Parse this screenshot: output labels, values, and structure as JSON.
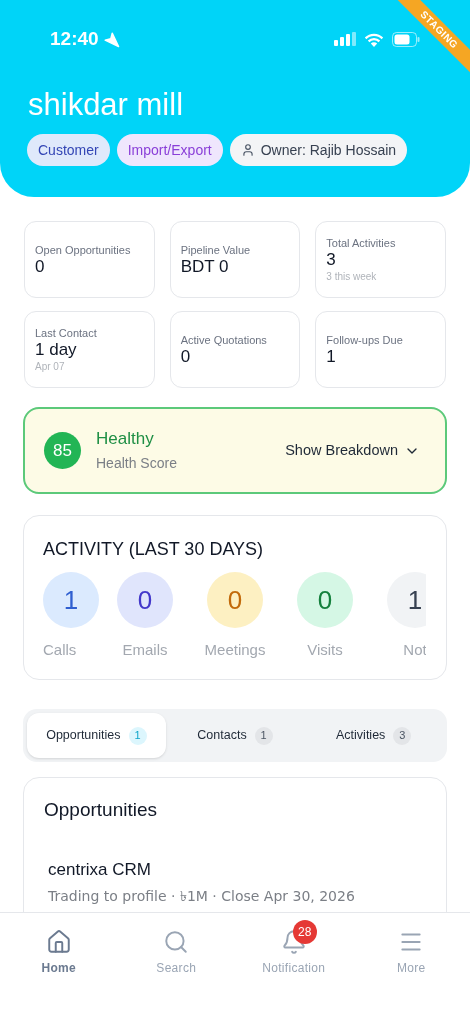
{
  "status_bar": {
    "time": "12:40"
  },
  "ribbon": {
    "label": "STAGING"
  },
  "header": {
    "title": "shikdar mill",
    "chips": [
      {
        "kind": "type",
        "label": "Customer"
      },
      {
        "kind": "industry",
        "label": "Import/Export"
      },
      {
        "kind": "owner",
        "label": "Owner: Rajib Hossain"
      }
    ]
  },
  "stats": [
    {
      "label": "Open Opportunities",
      "value": "0"
    },
    {
      "label": "Pipeline Value",
      "value": "BDT 0"
    },
    {
      "label": "Total Activities",
      "value": "3",
      "note": "3 this week"
    },
    {
      "label": "Last Contact",
      "value": "1 day",
      "note": "Apr 07"
    },
    {
      "label": "Active Quotations",
      "value": "0"
    },
    {
      "label": "Follow-ups Due",
      "value": "1"
    }
  ],
  "health": {
    "score": "85",
    "status": "Healthy",
    "caption": "Health Score",
    "toggle": "Show Breakdown",
    "expanded": false
  },
  "activity": {
    "title": "ACTIVITY (LAST 30 DAYS)",
    "items": [
      {
        "kind": "calls",
        "value": "1",
        "label": "Calls"
      },
      {
        "kind": "emails",
        "value": "0",
        "label": "Emails"
      },
      {
        "kind": "meetings",
        "value": "0",
        "label": "Meetings"
      },
      {
        "kind": "visits",
        "value": "0",
        "label": "Visits"
      },
      {
        "kind": "notes",
        "value": "1",
        "label": "Not"
      }
    ]
  },
  "tabs": [
    {
      "label": "Opportunities",
      "count": "1",
      "selected": true
    },
    {
      "label": "Contacts",
      "count": "1",
      "selected": false
    },
    {
      "label": "Activities",
      "count": "3",
      "selected": false
    }
  ],
  "opportunities": {
    "title": "Opportunities",
    "items": [
      {
        "name": "centrixa CRM",
        "details": "Trading to profile · ৳1M · Close Apr 30, 2026"
      }
    ]
  },
  "nav": [
    {
      "kind": "home",
      "label": "Home",
      "selected": true
    },
    {
      "kind": "search",
      "label": "Search",
      "selected": false
    },
    {
      "kind": "bell",
      "label": "Notification",
      "selected": false,
      "badge": "28"
    },
    {
      "kind": "menu",
      "label": "More",
      "selected": false
    }
  ]
}
